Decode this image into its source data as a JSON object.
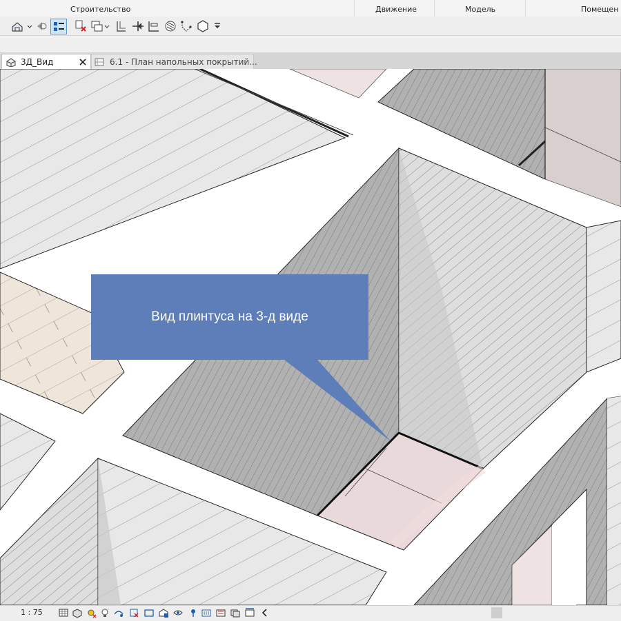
{
  "ribbon": {
    "groups": [
      "Строительство",
      "Движение",
      "Модель",
      "Помещен"
    ]
  },
  "toolbar": {
    "icons": [
      "home-view-icon",
      "navigate-icon",
      "thin-lines-icon",
      "close-hidden-icon",
      "switch-windows-icon",
      "section-icon",
      "align-icon",
      "measure-icon",
      "pattern-icon",
      "join-icon",
      "shape-icon",
      "more-icon"
    ]
  },
  "tabs": [
    {
      "label": "3Д_Вид",
      "active": true
    },
    {
      "label": "6.1 - План напольных покрытий..."
    }
  ],
  "callout": {
    "text": "Вид плинтуса на 3-д виде",
    "color": "#5e7eb9"
  },
  "statusbar": {
    "scale": "1 : 75"
  },
  "colors": {
    "wall_dark": "#aaaaaa",
    "wall_light": "#dcdcdc",
    "floor_light": "#e9e9e9",
    "wood": "#efe5da",
    "pink": "#eee2e2"
  }
}
